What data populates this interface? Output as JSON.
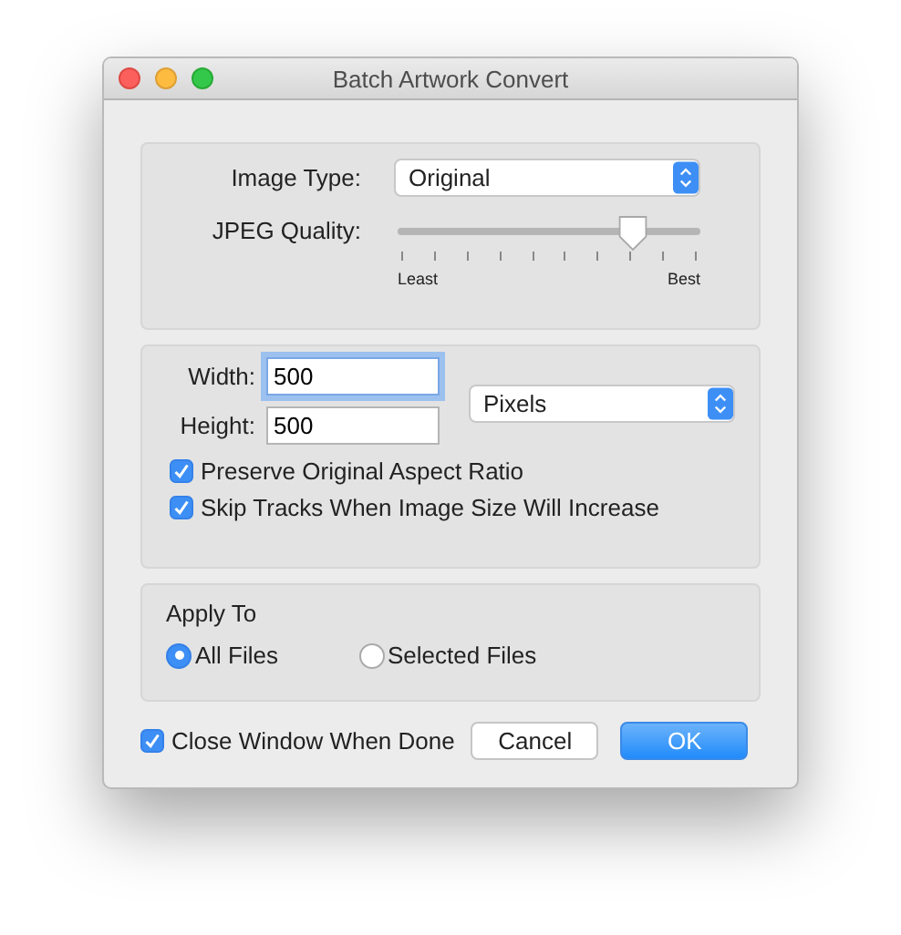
{
  "window": {
    "title": "Batch Artwork Convert"
  },
  "image_type": {
    "label": "Image Type:",
    "value": "Original"
  },
  "jpeg_quality": {
    "label": "JPEG Quality:",
    "level": 0.78,
    "min_label": "Least",
    "max_label": "Best"
  },
  "size": {
    "width_label": "Width:",
    "width_value": "500",
    "width_focused": true,
    "height_label": "Height:",
    "height_value": "500",
    "unit": "Pixels"
  },
  "options": [
    {
      "label": "Preserve Original Aspect Ratio",
      "checked": true
    },
    {
      "label": "Skip Tracks When Image Size Will Increase",
      "checked": true
    }
  ],
  "apply_to": {
    "title": "Apply To",
    "choices": [
      {
        "label": "All Files",
        "selected": true
      },
      {
        "label": "Selected Files",
        "selected": false
      }
    ]
  },
  "close_when_done": {
    "label": "Close Window When Done",
    "checked": true
  },
  "buttons": [
    {
      "label": "Cancel",
      "kind": "normal"
    },
    {
      "label": "OK",
      "kind": "default"
    }
  ]
}
